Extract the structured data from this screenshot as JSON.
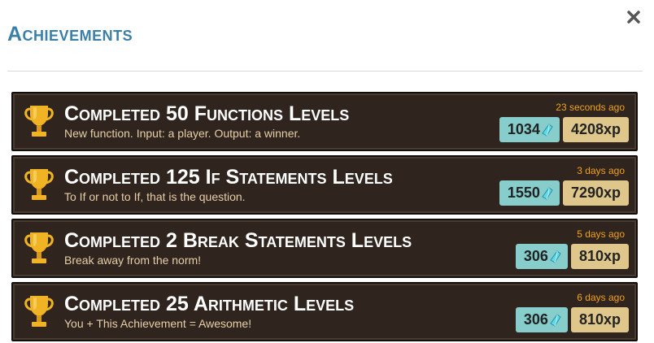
{
  "header": {
    "title": "Achievements",
    "close_icon": "close-icon"
  },
  "colors": {
    "title": "#3a7fa8",
    "card_background": "#2f241e",
    "card_time": "#f0a21d",
    "gem_badge": "#86cdcc",
    "xp_badge": "#dfc68b"
  },
  "achievements": [
    {
      "title": "Completed 50 Functions Levels",
      "description": "New function. Input: a player. Output: a winner.",
      "time": "23 seconds ago",
      "gems": "1034",
      "xp": "4208xp",
      "icon": "trophy-icon"
    },
    {
      "title": "Completed 125 If Statements Levels",
      "description": "To If or not to If, that is the question.",
      "time": "3 days ago",
      "gems": "1550",
      "xp": "7290xp",
      "icon": "trophy-icon"
    },
    {
      "title": "Completed 2 Break Statements Levels",
      "description": "Break away from the norm!",
      "time": "5 days ago",
      "gems": "306",
      "xp": "810xp",
      "icon": "trophy-icon"
    },
    {
      "title": "Completed 25 Arithmetic Levels",
      "description": "You + This Achievement = Awesome!",
      "time": "6 days ago",
      "gems": "306",
      "xp": "810xp",
      "icon": "trophy-icon"
    }
  ]
}
